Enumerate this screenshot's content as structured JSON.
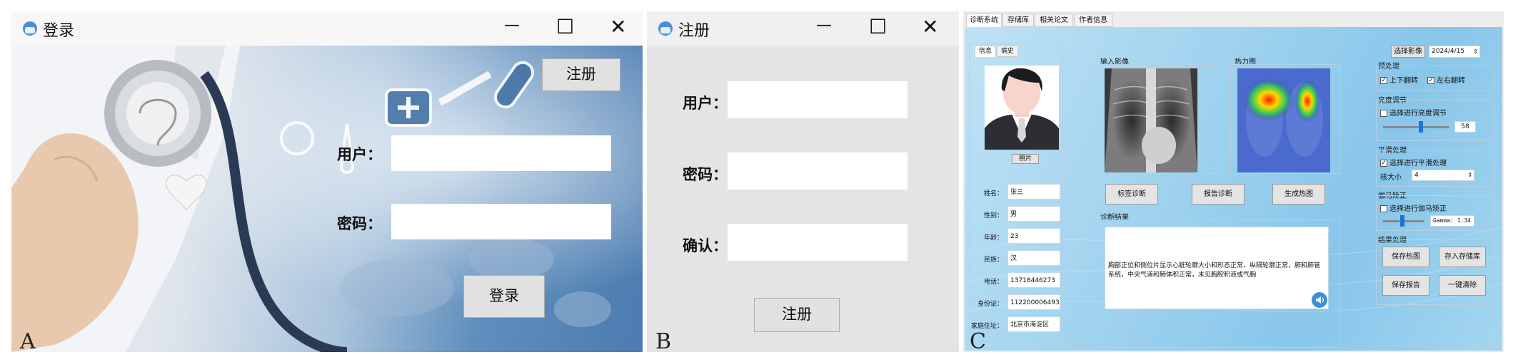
{
  "panel_letters": {
    "a": "A",
    "b": "B",
    "c": "C"
  },
  "login": {
    "title": "登录",
    "register_label": "注册",
    "user_label": "用户：",
    "password_label": "密码：",
    "login_label": "登录"
  },
  "register": {
    "title": "注册",
    "user_label": "用户：",
    "password_label": "密码：",
    "confirm_label": "确认：",
    "register_label": "注册"
  },
  "window_controls": {
    "minimize": "—",
    "maximize": "☐",
    "close": "✕"
  },
  "diag": {
    "tabs": [
      "诊断系统",
      "存储库",
      "相关论文",
      "作者信息"
    ],
    "subtabs": [
      "信息",
      "病史"
    ],
    "photo_button": "照片",
    "fields": [
      {
        "label": "姓名：",
        "value": "张三"
      },
      {
        "label": "性别：",
        "value": "男"
      },
      {
        "label": "年龄：",
        "value": "23"
      },
      {
        "label": "民族：",
        "value": "汉"
      },
      {
        "label": "电话：",
        "value": "13718446273"
      },
      {
        "label": "身份证：",
        "value": "112200006493054"
      },
      {
        "label": "家庭住址：",
        "value": "北京市海淀区"
      }
    ],
    "input_image_label": "输入影像",
    "heatmap_label": "热力图",
    "buttons": {
      "label_diag": "标签诊断",
      "report_diag": "报告诊断",
      "gen_heatmap": "生成热图"
    },
    "result_title": "诊断结果",
    "result_text": "胸部正位和侧位片显示心脏轮廓大小和形态正常，纵隔轮廓正常，肺和肺管系统，中央气道和肺体积正常，未见胸腔积液或气胸",
    "right": {
      "select_image": "选择影像",
      "date": "2024/4/15",
      "preprocess_title": "预处理",
      "flip_ud": "上下翻转",
      "flip_lr": "左右翻转",
      "brightness_title": "亮度调节",
      "brightness_check": "选择进行亮度调节",
      "brightness_value": "58",
      "brightness_level": 0.58,
      "smooth_title": "平滑处理",
      "smooth_check": "选择进行平滑处理",
      "kernel_label": "核大小",
      "kernel_value": "4",
      "gamma_title": "伽马矫正",
      "gamma_check": "选择进行伽马矫正",
      "gamma_value": "Gamma: 1.34",
      "result_proc_title": "结果处理",
      "save_heatmap": "保存热图",
      "save_repo": "存入存储库",
      "save_report": "保存报告",
      "clear_all": "一键清除"
    }
  }
}
